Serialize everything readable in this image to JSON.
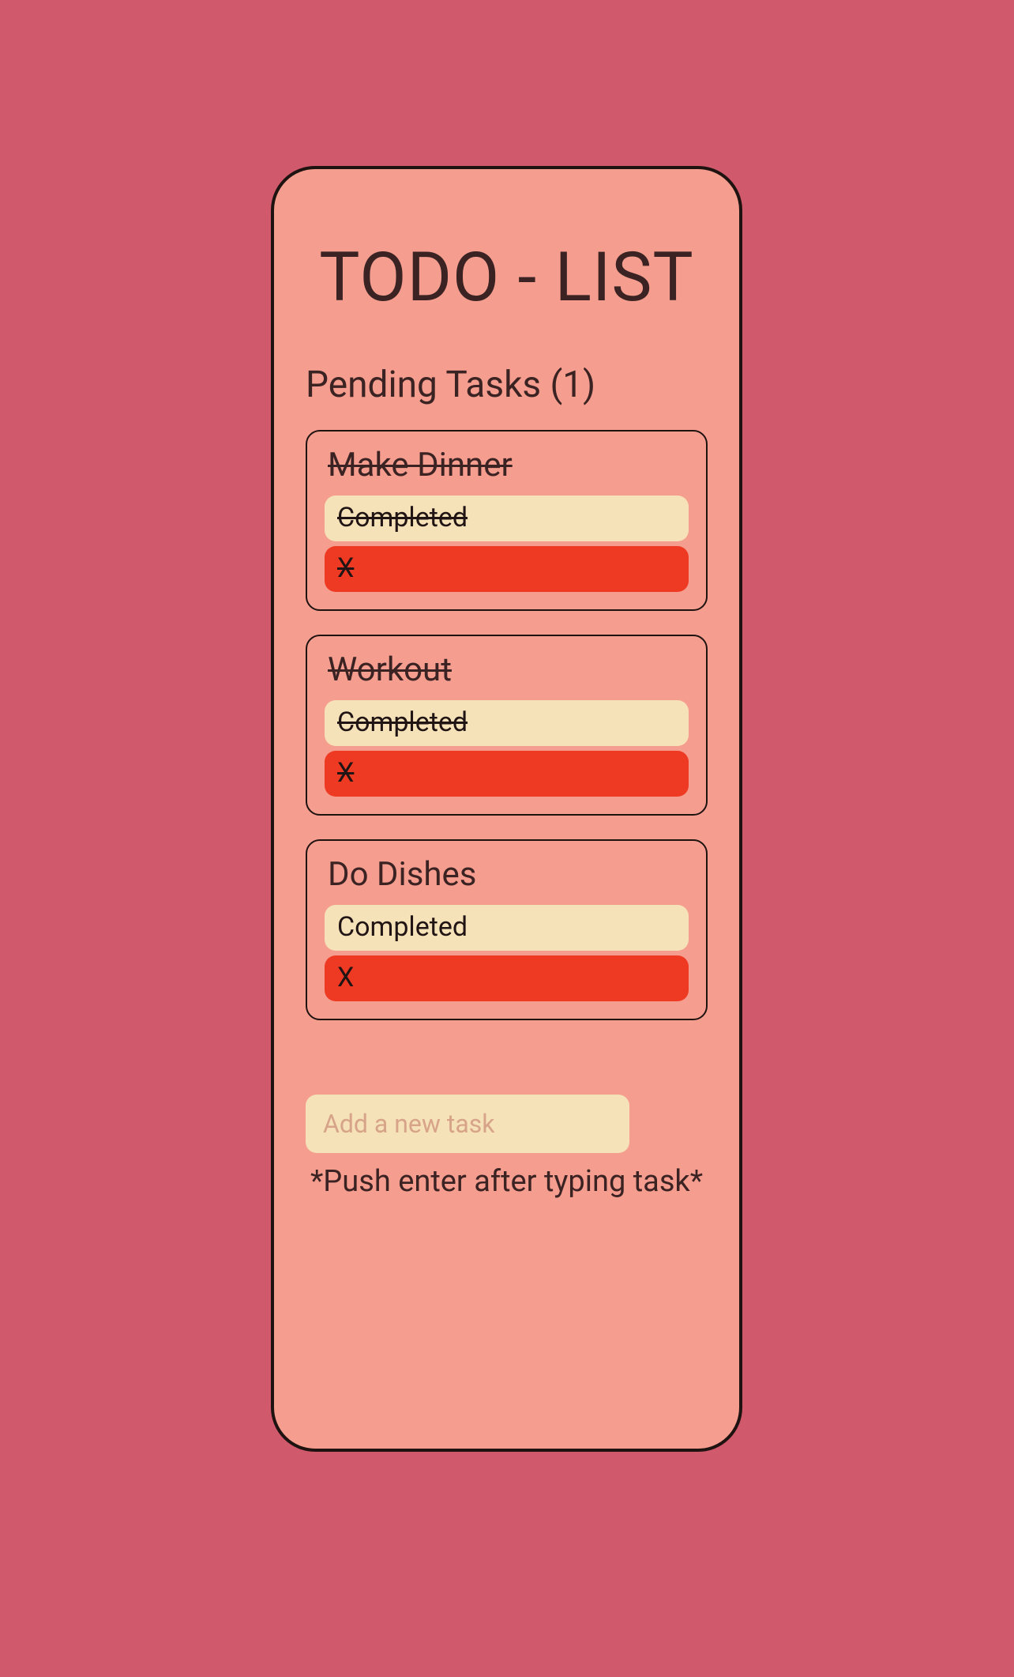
{
  "title": "TODO - LIST",
  "pending_label_prefix": "Pending Tasks (",
  "pending_count": 1,
  "pending_label_suffix": ")",
  "tasks": [
    {
      "title": "Make Dinner",
      "completed": true,
      "completed_label": "Completed",
      "delete_label": "X"
    },
    {
      "title": "Workout",
      "completed": true,
      "completed_label": "Completed",
      "delete_label": "X"
    },
    {
      "title": "Do Dishes",
      "completed": false,
      "completed_label": "Completed",
      "delete_label": "X"
    }
  ],
  "input": {
    "placeholder": "Add a new task",
    "value": ""
  },
  "hint": "*Push enter after typing task*"
}
